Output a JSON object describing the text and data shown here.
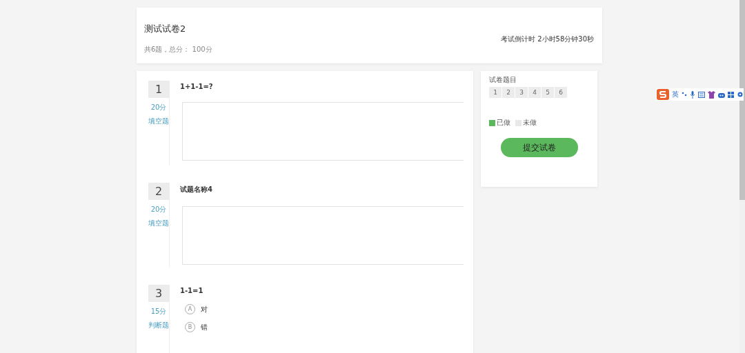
{
  "header": {
    "title": "测试试卷2",
    "summary": "共6题，总分： 100分",
    "timer": "考试倒计时 2小时58分钟30秒"
  },
  "questions": [
    {
      "number": "1",
      "score": "20分",
      "type_label": "填空题",
      "kind": "fill",
      "text": "1+1-1=?"
    },
    {
      "number": "2",
      "score": "20分",
      "type_label": "填空题",
      "kind": "fill",
      "text": "试题名称4"
    },
    {
      "number": "3",
      "score": "15分",
      "type_label": "判断题",
      "kind": "choice",
      "text": "1-1=1",
      "options": [
        {
          "letter": "A",
          "text": "对",
          "selected": false
        },
        {
          "letter": "B",
          "text": "错",
          "selected": false
        }
      ]
    }
  ],
  "sidebar": {
    "title": "试卷题目",
    "items": [
      {
        "label": "1",
        "done": false
      },
      {
        "label": "2",
        "done": false
      },
      {
        "label": "3",
        "done": false
      },
      {
        "label": "4",
        "done": false
      },
      {
        "label": "5",
        "done": false
      },
      {
        "label": "6",
        "done": false
      }
    ],
    "legend": [
      {
        "label": "已做",
        "color": "#5cb85c"
      },
      {
        "label": "未做",
        "color": "#e8e8e8"
      }
    ],
    "submit_button": "提交试卷"
  },
  "ime_toolbar": {
    "mode": "英"
  }
}
